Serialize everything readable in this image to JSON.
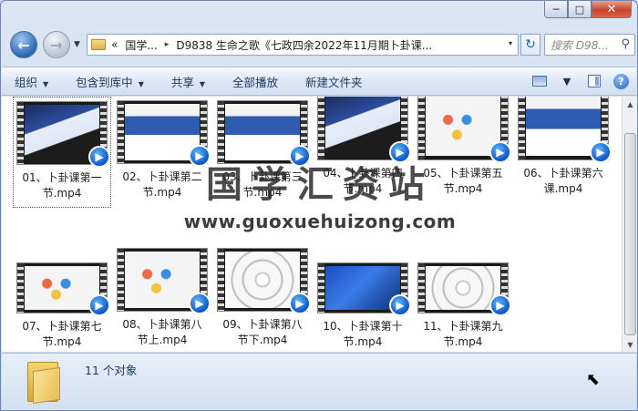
{
  "window": {
    "caption_buttons": {
      "minimize": "─",
      "maximize": "□",
      "close": "✕"
    }
  },
  "nav": {
    "back_icon": "back-arrow-icon",
    "forward_icon": "forward-arrow-icon",
    "history_glyph": "▼",
    "address": {
      "prefix": "«",
      "crumb1": "国学...",
      "separator": "▸",
      "crumb2": "D9838 生命之歌《七政四余2022年11月期卜卦课...",
      "dropdown": "▾"
    },
    "refresh_glyph": "↻",
    "search_placeholder": "搜索 D98...",
    "search_glyph": "⚲"
  },
  "toolbar": {
    "organize": "组织",
    "include": "包含到库中",
    "share": "共享",
    "play_all": "全部播放",
    "new_folder": "新建文件夹",
    "dropdown_glyph": "▼",
    "help": "?"
  },
  "files": [
    {
      "name": "01、卜卦课第一节.mp4",
      "l1": "01、卜卦课第一",
      "l2": "节.mp4"
    },
    {
      "name": "02、卜卦课第二节.mp4",
      "l1": "02、卜卦课第二",
      "l2": "节.mp4"
    },
    {
      "name": "03、卜卦课第三节.mp4",
      "l1": "03、卜卦课第三",
      "l2": "节.mp4"
    },
    {
      "name": "04、卜卦课第四节.mp4",
      "l1": "04、卜卦课第四",
      "l2": "节.mp4"
    },
    {
      "name": "05、卜卦课第五节.mp4",
      "l1": "05、卜卦课第五",
      "l2": "节.mp4"
    },
    {
      "name": "06、卜卦课第六课.mp4",
      "l1": "06、卜卦课第六",
      "l2": "课.mp4"
    },
    {
      "name": "07、卜卦课第七节.mp4",
      "l1": "07、卜卦课第七",
      "l2": "节.mp4"
    },
    {
      "name": "08、卜卦课第八节上.mp4",
      "l1": "08、卜卦课第八",
      "l2": "节上.mp4"
    },
    {
      "name": "09、卜卦课第八节下.mp4",
      "l1": "09、卜卦课第八",
      "l2": "节下.mp4"
    },
    {
      "name": "10、卜卦课第十节.mp4",
      "l1": "10、卜卦课第十",
      "l2": "节.mp4"
    },
    {
      "name": "11、卜卦课第九节.mp4",
      "l1": "11、卜卦课第九",
      "l2": "节.mp4"
    }
  ],
  "watermark": {
    "title": "国学汇资站",
    "url": "www.guoxuehuizong.com"
  },
  "details": {
    "count": "11 个对象"
  }
}
